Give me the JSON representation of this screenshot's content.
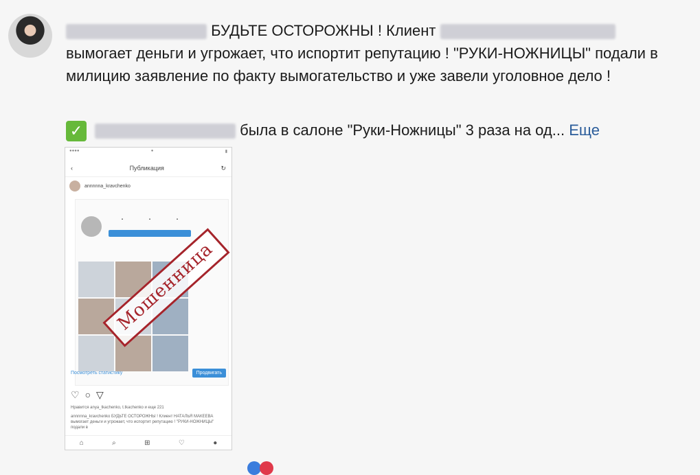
{
  "post": {
    "text_part1": "БУДЬТЕ ОСТОРОЖНЫ ! Клиент",
    "text_part2": "вымогает деньги и угрожает, что испортит репутацию ! \"РУКИ-НОЖНИЦЫ\" подали в милицию заявление по факту вымогательство и уже завели уголовное дело !"
  },
  "quote": {
    "text": "была в салоне \"Руки-Ножницы\" 3 раза на од...",
    "more_label": "Еще"
  },
  "phone": {
    "header_title": "Публикация",
    "username": "annnnna_kravchenko",
    "stamp_text": "Мошенница",
    "stats_link": "Посмотреть статистику",
    "promote_label": "Продвигать",
    "likes_text": "Нравится anya_tkachenko, t.tkachenko и еще 221",
    "caption_text": "annnnna_kravchenko БУДЬТЕ ОСТОРОЖНЫ ! Клиент НАТАЛЬЯ МАКЕЕВА вымогает деньги и угрожает, что испортит репутацию ! \"РУКИ-НОЖНИЦЫ\" подали в"
  },
  "colors": {
    "check": "#66b93a",
    "link": "#2a5c9a",
    "stamp": "#a5242b",
    "ig_blue": "#3b8fd8"
  }
}
